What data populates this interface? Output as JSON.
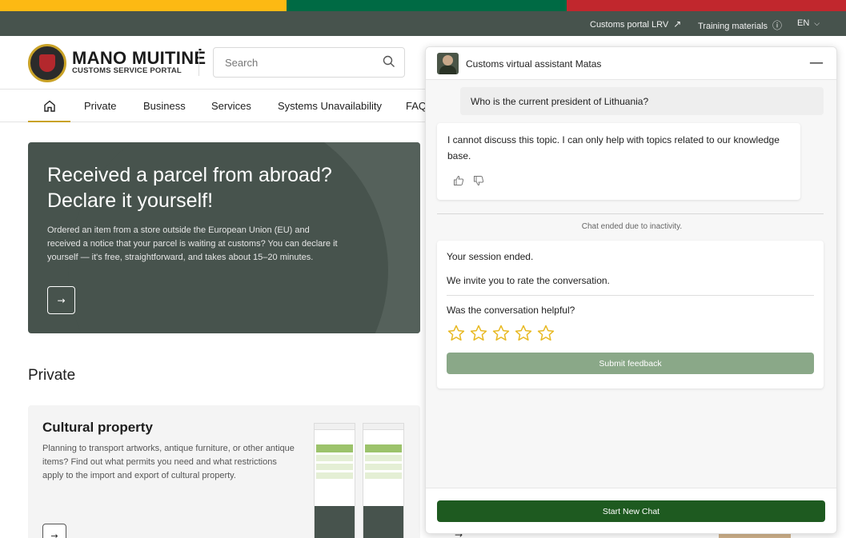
{
  "colors": {
    "flag_yellow": "#fdb913",
    "flag_green": "#006a44",
    "flag_red": "#c1272d",
    "topbar_bg": "#47534d",
    "hero_bg": "#47534d",
    "accent_gold": "#c9a227",
    "submit_btn": "#8aa888",
    "new_chat_btn": "#1e5a20",
    "star_outline": "#e8b923"
  },
  "topbar": {
    "portal_link": "Customs portal LRV",
    "portal_icon": "external-link-icon",
    "training_link": "Training materials",
    "training_icon": "info-icon",
    "language": "EN",
    "language_icon": "chevron-down-icon"
  },
  "header": {
    "logo_title": "MANO MUITINĖ",
    "logo_subtitle": "CUSTOMS SERVICE PORTAL",
    "search_placeholder": "Search"
  },
  "nav": {
    "items": [
      {
        "label": "Private"
      },
      {
        "label": "Business"
      },
      {
        "label": "Services"
      },
      {
        "label": "Systems Unavailability"
      },
      {
        "label": "FAQ"
      }
    ]
  },
  "hero": {
    "title": "Received a parcel from abroad? Declare it yourself!",
    "text": "Ordered an item from a store outside the European Union (EU) and received a notice that your parcel is waiting at customs? You can declare it yourself — it's free, straightforward, and takes about 15–20 minutes.",
    "button_glyph": "→"
  },
  "private_section": {
    "title": "Private",
    "card": {
      "title": "Cultural property",
      "text": "Planning to transport artworks, antique furniture, or other antique items? Find out what permits you need and what restrictions apply to the import and export of cultural property.",
      "button_glyph": "→"
    },
    "right_card_button_glyph": "→"
  },
  "chat": {
    "title": "Customs virtual assistant Matas",
    "minimize_glyph": "—",
    "user_message": "Who is the current president of Lithuania?",
    "bot_message": "I cannot discuss this topic. I can only help with topics related to our knowledge base.",
    "ended_note": "Chat ended due to inactivity.",
    "session_ended": "Your session ended.",
    "rate_invite": "We invite you to rate the conversation.",
    "helpful_question": "Was the conversation helpful?",
    "stars": [
      1,
      2,
      3,
      4,
      5
    ],
    "star_rating": 0,
    "submit_label": "Submit feedback",
    "new_chat_label": "Start New Chat"
  }
}
